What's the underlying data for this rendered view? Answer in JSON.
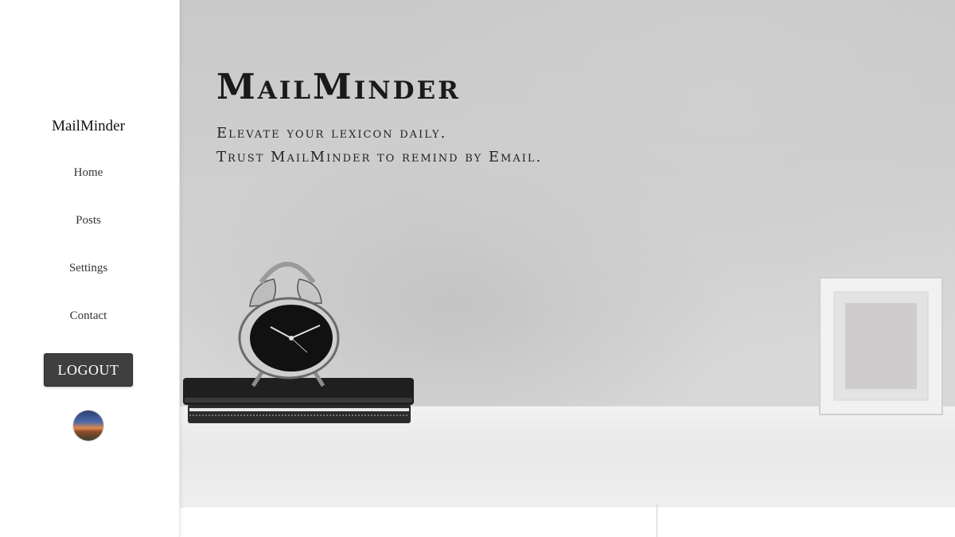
{
  "sidebar": {
    "brand": "MailMinder",
    "nav": [
      {
        "label": "Home"
      },
      {
        "label": "Posts"
      },
      {
        "label": "Settings"
      },
      {
        "label": "Contact"
      }
    ],
    "logout_label": "LOGOUT"
  },
  "hero": {
    "title": "MailMinder",
    "lines": [
      "Elevate your lexicon daily.",
      "Trust MailMinder to remind by Email."
    ]
  },
  "colors": {
    "logout_bg": "#3f3f3f",
    "text": "#111111"
  }
}
